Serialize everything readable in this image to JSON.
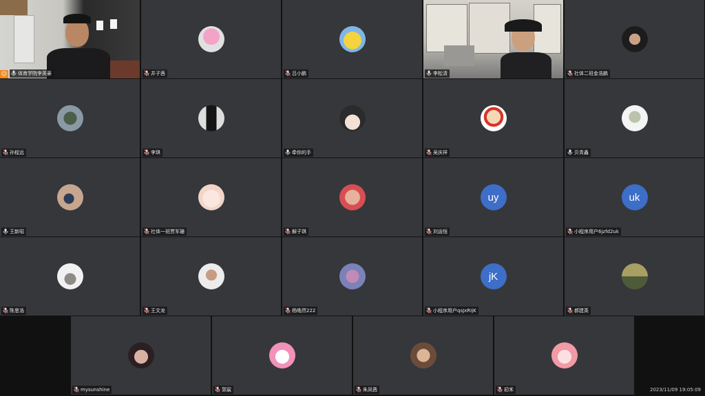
{
  "meeting": {
    "timestamp": "2023/11/09 19:05:09"
  },
  "colors": {
    "initials_bg": "#3d6ec8",
    "active_border": "#2ecc71",
    "host_badge": "#f08a24",
    "tile_bg": "#36373b"
  },
  "rows": [
    {
      "tiles": [
        {
          "name": "体育学院李英豪",
          "kind": "video",
          "scene": "room",
          "host": true
        },
        {
          "name": "井子茜",
          "avatar": "pink-hair",
          "muted": true
        },
        {
          "name": "吕小鹏",
          "avatar": "pikachu",
          "muted": true
        },
        {
          "name": "李松清",
          "kind": "video",
          "scene": "office",
          "active": true
        },
        {
          "name": "社体二班金浩鹏",
          "avatar": "dark-photo",
          "muted": true
        }
      ]
    },
    {
      "tiles": [
        {
          "name": "孙程远",
          "avatar": "outdoor",
          "muted": true
        },
        {
          "name": "李琪",
          "avatar": "dark-figure",
          "muted": true
        },
        {
          "name": "牵你的手",
          "avatar": "anime-boy",
          "muted": false
        },
        {
          "name": "吴庆祥",
          "avatar": "cartoon-kid",
          "muted": true
        },
        {
          "name": "贝青鑫",
          "avatar": "sketch",
          "muted": false
        }
      ]
    },
    {
      "tiles": [
        {
          "name": "王新昭",
          "avatar": "camera",
          "muted": false
        },
        {
          "name": "社体一班贾军珊",
          "avatar": "cute-blob",
          "muted": true
        },
        {
          "name": "解子琪",
          "avatar": "baby",
          "muted": true
        },
        {
          "name": "刘运恒",
          "initials": "uy",
          "muted": true
        },
        {
          "name": "小程序用户6jzfd2uk",
          "initials": "uk",
          "muted": true
        }
      ]
    },
    {
      "tiles": [
        {
          "name": "陈思浩",
          "avatar": "cat-meme",
          "muted": true
        },
        {
          "name": "王文龙",
          "avatar": "boy-photo",
          "muted": true
        },
        {
          "name": "杨皓然222",
          "avatar": "purple-art",
          "muted": true
        },
        {
          "name": "小程序用户qsJxRIjK",
          "initials": "jK",
          "muted": true
        },
        {
          "name": "郝建英",
          "avatar": "landscape",
          "muted": true
        }
      ]
    },
    {
      "tiles": [
        {
          "name": "mysunshine",
          "avatar": "girl-photo",
          "muted": true
        },
        {
          "name": "郭宸",
          "avatar": "pink-girl",
          "muted": true
        },
        {
          "name": "朱凤茜",
          "avatar": "couple",
          "muted": true
        },
        {
          "name": "初禾",
          "avatar": "anime-girl",
          "muted": true
        }
      ]
    }
  ]
}
